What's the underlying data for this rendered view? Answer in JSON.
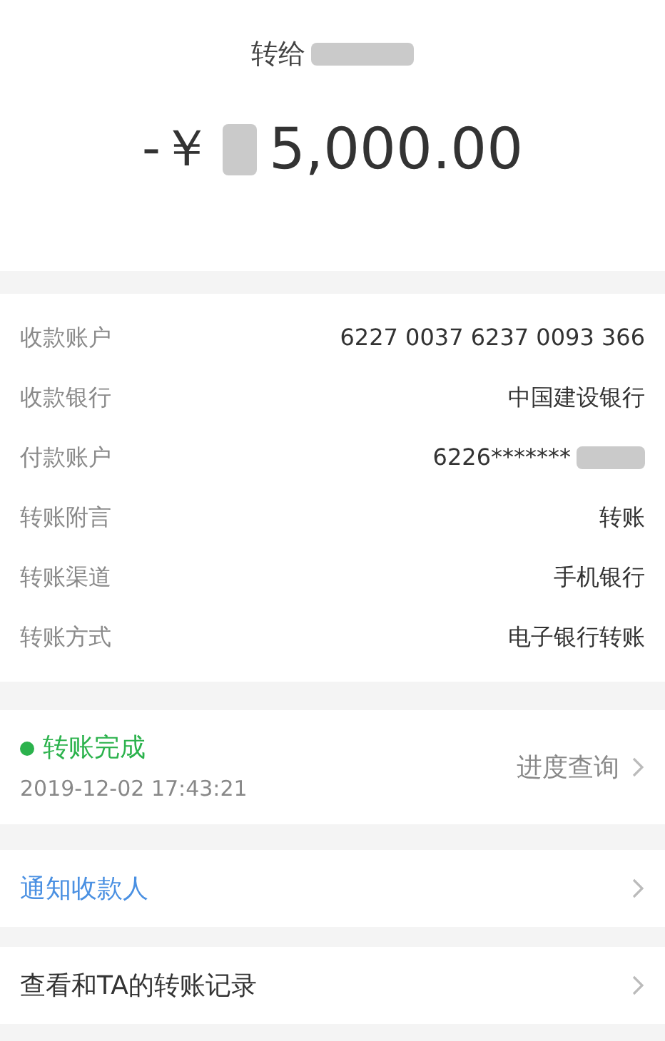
{
  "header": {
    "title": "转给",
    "title_redacted": true,
    "amount_sign": "-￥",
    "amount_redacted": true,
    "amount": "5,000.00"
  },
  "details": [
    {
      "label": "收款账户",
      "value": "6227 0037 6237 0093 366",
      "redacted": false
    },
    {
      "label": "收款银行",
      "value": "中国建设银行",
      "redacted": false
    },
    {
      "label": "付款账户",
      "value": "6226*******",
      "redacted": true
    },
    {
      "label": "转账附言",
      "value": "转账",
      "redacted": false
    },
    {
      "label": "转账渠道",
      "value": "手机银行",
      "redacted": false
    },
    {
      "label": "转账方式",
      "value": "电子银行转账",
      "redacted": false
    }
  ],
  "status": {
    "label": "转账完成",
    "color": "#2bb24c",
    "time": "2019-12-02 17:43:21",
    "action": "进度查询"
  },
  "links": [
    {
      "label": "通知收款人",
      "kind": "highlight"
    },
    {
      "label": "查看和TA的转账记录",
      "kind": "plain"
    }
  ]
}
